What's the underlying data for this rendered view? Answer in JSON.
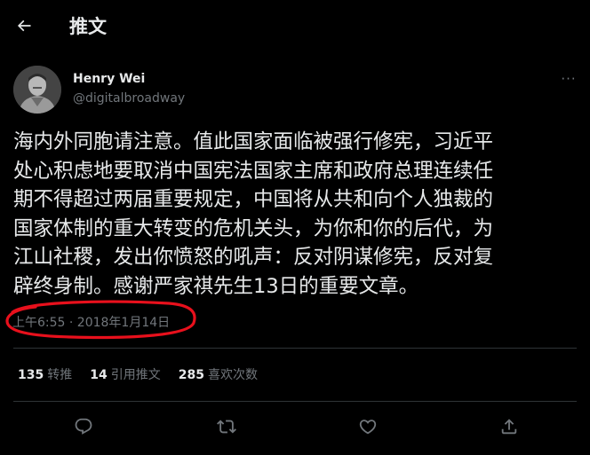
{
  "header": {
    "title": "推文",
    "back_icon": "arrow-left-icon"
  },
  "author": {
    "name": "Henry Wei",
    "handle": "@digitalbroadway",
    "avatar_icon": "avatar-portrait"
  },
  "more_icon": "more-horizontal-icon",
  "more_label": "···",
  "tweet": {
    "text": "海内外同胞请注意。值此国家面临被强行修宪，习近平\n处心积虑地要取消中国宪法国家主席和政府总理连续任\n期不得超过两届重要规定，中国将从共和向个人独裁的\n国家体制的重大转变的危机关头，为你和你的后代，为\n江山社稷，发出你愤怒的吼声：反对阴谋修宪，反对复\n辟终身制。感谢严家祺先生13日的重要文章。",
    "timestamp": "上午6:55 · 2018年1月14日"
  },
  "stats": [
    {
      "count": "135",
      "label": "转推"
    },
    {
      "count": "14",
      "label": "引用推文"
    },
    {
      "count": "285",
      "label": "喜欢次数"
    }
  ],
  "actions": [
    {
      "icon": "reply-icon"
    },
    {
      "icon": "retweet-icon"
    },
    {
      "icon": "like-icon"
    },
    {
      "icon": "share-icon"
    }
  ],
  "colors": {
    "background": "#000000",
    "text_primary": "#e7e9ea",
    "text_secondary": "#71767b",
    "divider": "#2f3336",
    "annotation_circle": "#e8101c"
  }
}
